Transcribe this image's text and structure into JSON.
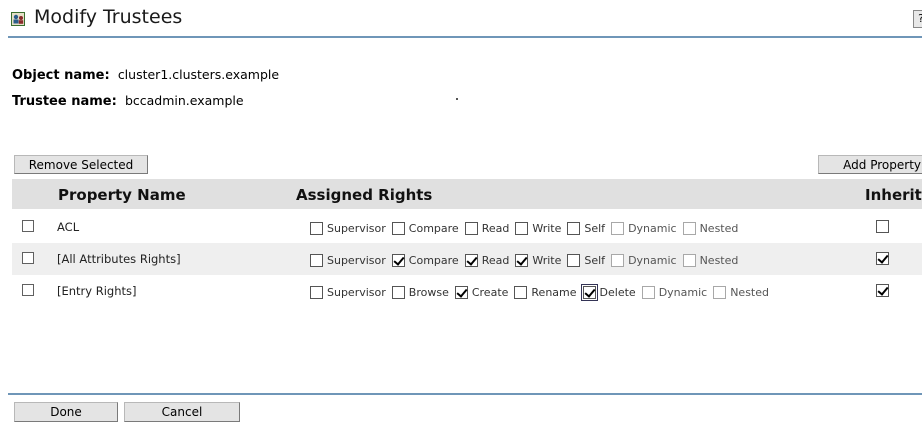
{
  "title": "Modify Trustees",
  "help_label": "?",
  "object": {
    "label": "Object name:",
    "value": "cluster1.clusters.example"
  },
  "trustee": {
    "label": "Trustee name:",
    "value": "bccadmin.example"
  },
  "buttons": {
    "remove": "Remove Selected",
    "add_property": "Add Property",
    "done": "Done",
    "cancel": "Cancel"
  },
  "table": {
    "headers": {
      "property": "Property Name",
      "rights": "Assigned Rights",
      "inherit": "Inherit"
    },
    "rows": [
      {
        "name": "ACL",
        "rights": [
          {
            "label": "Supervisor",
            "checked": false,
            "disabled": false
          },
          {
            "label": "Compare",
            "checked": false,
            "disabled": false
          },
          {
            "label": "Read",
            "checked": false,
            "disabled": false
          },
          {
            "label": "Write",
            "checked": false,
            "disabled": false
          },
          {
            "label": "Self",
            "checked": false,
            "disabled": false
          },
          {
            "label": "Dynamic",
            "checked": false,
            "disabled": true
          },
          {
            "label": "Nested",
            "checked": false,
            "disabled": true
          }
        ],
        "inherit": false
      },
      {
        "name": "[All Attributes Rights]",
        "rights": [
          {
            "label": "Supervisor",
            "checked": false,
            "disabled": false
          },
          {
            "label": "Compare",
            "checked": true,
            "disabled": false
          },
          {
            "label": "Read",
            "checked": true,
            "disabled": false
          },
          {
            "label": "Write",
            "checked": true,
            "disabled": false
          },
          {
            "label": "Self",
            "checked": false,
            "disabled": false
          },
          {
            "label": "Dynamic",
            "checked": false,
            "disabled": true
          },
          {
            "label": "Nested",
            "checked": false,
            "disabled": true
          }
        ],
        "inherit": true
      },
      {
        "name": "[Entry Rights]",
        "rights": [
          {
            "label": "Supervisor",
            "checked": false,
            "disabled": false
          },
          {
            "label": "Browse",
            "checked": false,
            "disabled": false
          },
          {
            "label": "Create",
            "checked": true,
            "disabled": false
          },
          {
            "label": "Rename",
            "checked": false,
            "disabled": false
          },
          {
            "label": "Delete",
            "checked": true,
            "disabled": false,
            "focused": true
          },
          {
            "label": "Dynamic",
            "checked": false,
            "disabled": true
          },
          {
            "label": "Nested",
            "checked": false,
            "disabled": true
          }
        ],
        "inherit": true
      }
    ]
  }
}
